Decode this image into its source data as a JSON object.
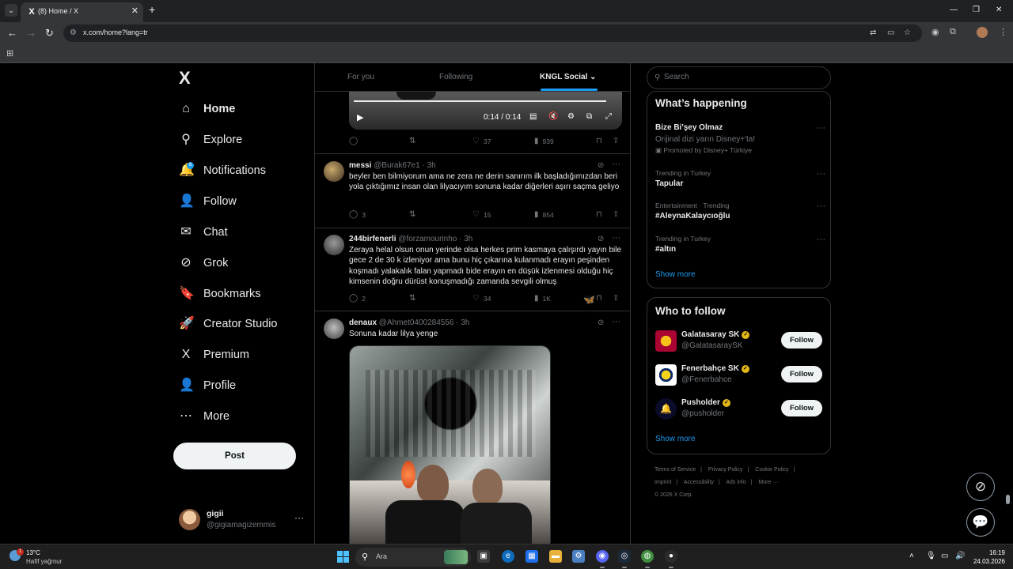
{
  "browser": {
    "tab_title": "(8) Home / X",
    "tab_favicon": "X",
    "url": "x.com/home?lang=tr"
  },
  "nav": {
    "logo": "X",
    "items": [
      {
        "label": "Home",
        "icon": "home-icon",
        "glyph": "⌂",
        "active": true
      },
      {
        "label": "Explore",
        "icon": "search-icon",
        "glyph": "⚲"
      },
      {
        "label": "Notifications",
        "icon": "bell-icon",
        "glyph": "🔔",
        "badge": "8"
      },
      {
        "label": "Follow",
        "icon": "add-user-icon",
        "glyph": "👤"
      },
      {
        "label": "Chat",
        "icon": "mail-icon",
        "glyph": "✉"
      },
      {
        "label": "Grok",
        "icon": "grok-icon",
        "glyph": "⊘"
      },
      {
        "label": "Bookmarks",
        "icon": "bookmark-icon",
        "glyph": "🔖"
      },
      {
        "label": "Creator Studio",
        "icon": "rocket-icon",
        "glyph": "🚀"
      },
      {
        "label": "Premium",
        "icon": "x-premium-icon",
        "glyph": "X"
      },
      {
        "label": "Profile",
        "icon": "person-icon",
        "glyph": "👤"
      },
      {
        "label": "More",
        "icon": "more-circle-icon",
        "glyph": "⋯"
      }
    ],
    "post_label": "Post",
    "account": {
      "name": "gigii",
      "handle": "@gigiamagizemmis"
    }
  },
  "feed": {
    "tabs": [
      "For you",
      "Following",
      "KNGL Social"
    ],
    "active_tab": "KNGL Social",
    "video": {
      "time": "0:14 / 0:14"
    },
    "first_actions": {
      "replies": "",
      "reposts": "",
      "likes": "37",
      "views": "939"
    },
    "tweets": [
      {
        "name": "messi",
        "handle": "@Burak67e1",
        "time": "3h",
        "text": "beyler ben bilmiyorum ama ne zera ne derin sanırım ilk başladığımızdan beri yola çıktığımız insan olan lilyacıyım sonuna kadar diğerleri aşırı saçma geliyo",
        "replies": "3",
        "reposts": "",
        "likes": "15",
        "views": "854"
      },
      {
        "name": "244birfenerli",
        "handle": "@forzamourinho",
        "time": "3h",
        "text": "Zeraya helal olsun onun yerinde olsa herkes prim kasmaya çalışırdı yayın bile gece 2 de 30 k izleniyor ama bunu hiç çıkarına kulanmadı erayın peşinden koşmadı yalakalık falan yapmadı bide erayın en düşük izlenmesi olduğu hiç kimsenin doğru dürüst konuşmadığı zamanda sevgili olmuş",
        "replies": "2",
        "reposts": "",
        "likes": "34",
        "views": "1K"
      },
      {
        "name": "denaux",
        "handle": "@Ahmet0400284556",
        "time": "3h",
        "text": "Sonuna kadar lilya yenge"
      }
    ]
  },
  "sidebar": {
    "search_placeholder": "Search",
    "happening_title": "What’s happening",
    "trends": [
      {
        "category": "",
        "title": "Bize Bi'şey Olmaz",
        "sub": "Orijinal dizi yarın Disney+'ta!",
        "promo": "Promoted by Disney+ Türkiye"
      },
      {
        "category": "Trending in Turkey",
        "title": "Tapular"
      },
      {
        "category": "Entertainment · Trending",
        "title": "#AleynaKalaycıoğlu"
      },
      {
        "category": "Trending in Turkey",
        "title": "#altın"
      }
    ],
    "show_more": "Show more",
    "who_title": "Who to follow",
    "who": [
      {
        "name": "Galatasaray SK",
        "handle": "@GalatasaraySK",
        "follow": "Follow",
        "color": "#a90432"
      },
      {
        "name": "Fenerbahçe SK",
        "handle": "@Fenerbahce",
        "follow": "Follow",
        "color": "#ffffff"
      },
      {
        "name": "Pusholder",
        "handle": "@pusholder",
        "follow": "Follow",
        "color": "#0b0b2a"
      }
    ],
    "footer": [
      "Terms of Service",
      "|",
      "Privacy Policy",
      "|",
      "Cookie Policy",
      "|",
      "Imprint",
      "|",
      "Accessibility",
      "|",
      "Ads info",
      "|",
      "More ···",
      "© 2026 X Corp."
    ]
  },
  "taskbar": {
    "temperature": "13°C",
    "condition": "Hafif yağmur",
    "weather_badge": "1",
    "search_label": "Ara",
    "time": "16:19",
    "date": "24.03.2026"
  },
  "colors": {
    "accent": "#1d9bf0",
    "background": "#000000",
    "muted": "#71767b",
    "verified": "#e2b719"
  }
}
